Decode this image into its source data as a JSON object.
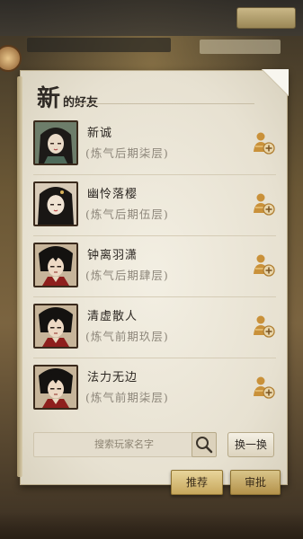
{
  "dialog": {
    "title_big": "新",
    "title_small": "的好友"
  },
  "friends": [
    {
      "name": "新诚",
      "realm": "(炼气后期柒层)",
      "avatar_icon": "female-cultivator-portrait",
      "add_icon": "add-friend-icon"
    },
    {
      "name": "幽怜落樱",
      "realm": "(炼气后期伍层)",
      "avatar_icon": "female-cultivator-portrait",
      "add_icon": "add-friend-icon"
    },
    {
      "name": "钟离羽潇",
      "realm": "(炼气后期肆层)",
      "avatar_icon": "male-cultivator-portrait",
      "add_icon": "add-friend-icon"
    },
    {
      "name": "清虚散人",
      "realm": "(炼气前期玖层)",
      "avatar_icon": "male-cultivator-portrait",
      "add_icon": "add-friend-icon"
    },
    {
      "name": "法力无边",
      "realm": "(炼气前期柒层)",
      "avatar_icon": "male-cultivator-portrait",
      "add_icon": "add-friend-icon"
    }
  ],
  "search": {
    "placeholder": "搜索玩家名字",
    "icon": "search-icon"
  },
  "refresh_label": "换一换",
  "tabs": {
    "recommend": "推荐",
    "approve": "审批"
  },
  "colors": {
    "paper": "#f3efe3",
    "name_text": "#2c2722",
    "realm_text": "#8e877b",
    "tab_gold": "#c7a75c"
  }
}
